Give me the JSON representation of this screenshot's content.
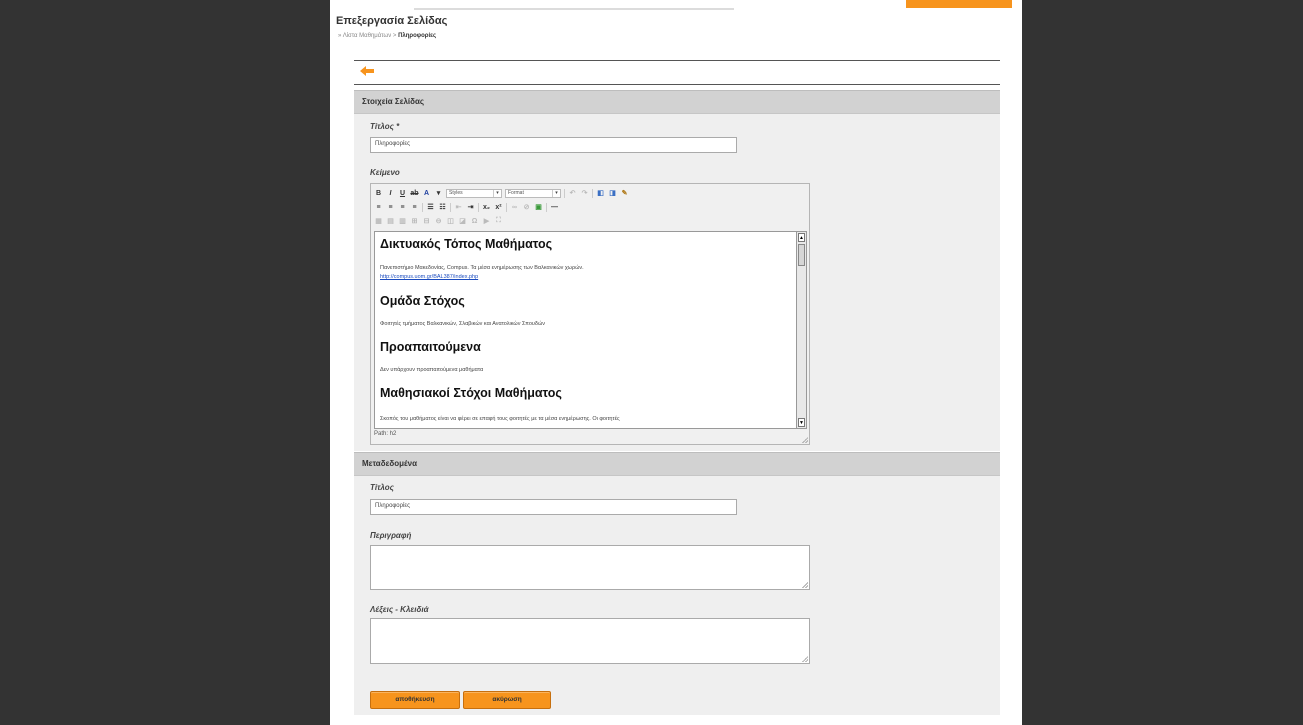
{
  "page": {
    "title": "Επεξεργασία Σελίδας",
    "breadcrumb": {
      "prefix": "»",
      "parent": "Λίστα Μαθημάτων",
      "separator": ">",
      "current": "Πληροφορίες"
    }
  },
  "icons": {
    "back": "back-arrow-icon"
  },
  "colors": {
    "accent": "#f7941d",
    "section_header": "#d2d2d2",
    "panel": "#efefef",
    "backdrop": "#333333"
  },
  "section_page": {
    "header": "Στοιχεία Σελίδας",
    "title_label": "Τίτλος *",
    "title_value": "Πληροφορίες",
    "body_label": "Κείμενο"
  },
  "editor": {
    "styles_combo": "Styles",
    "format_combo": "Format",
    "path": "Path: h2",
    "content": {
      "h1": "Δικτυακός Τόπος Μαθήματος",
      "p1": "Πανεπιστήμιο Μακεδονίας, Compus. Τα μέσα ενημέρωσης των Βαλκανικών χωρών.",
      "link1": "http://compus.uom.gr/BAL387/index.php",
      "h2": "Ομάδα Στόχος",
      "p2": "Φοιτητές τμήματος Βαλκανικών, Σλαβικών και Ανατολικών Σπουδών",
      "h3": "Προαπαιτούμενα",
      "p3": "Δεν υπάρχουν προαπαιτούμενα μαθήματα",
      "h4": "Μαθησιακοί Στόχοι Μαθήματος",
      "p4": "Σκοπός του μαθήματος είναι να φέρει σε επαφή τους φοιτητές με τα μέσα ενημέρωσης. Οι φοιτητές"
    }
  },
  "section_meta": {
    "header": "Μεταδεδομένα",
    "title_label": "Τίτλος",
    "title_value": "Πληροφορίες",
    "description_label": "Περιγραφή",
    "description_value": "",
    "keywords_label": "Λέξεις - Κλειδιά",
    "keywords_value": ""
  },
  "actions": {
    "save": "αποθήκευση",
    "cancel": "ακύρωση"
  }
}
